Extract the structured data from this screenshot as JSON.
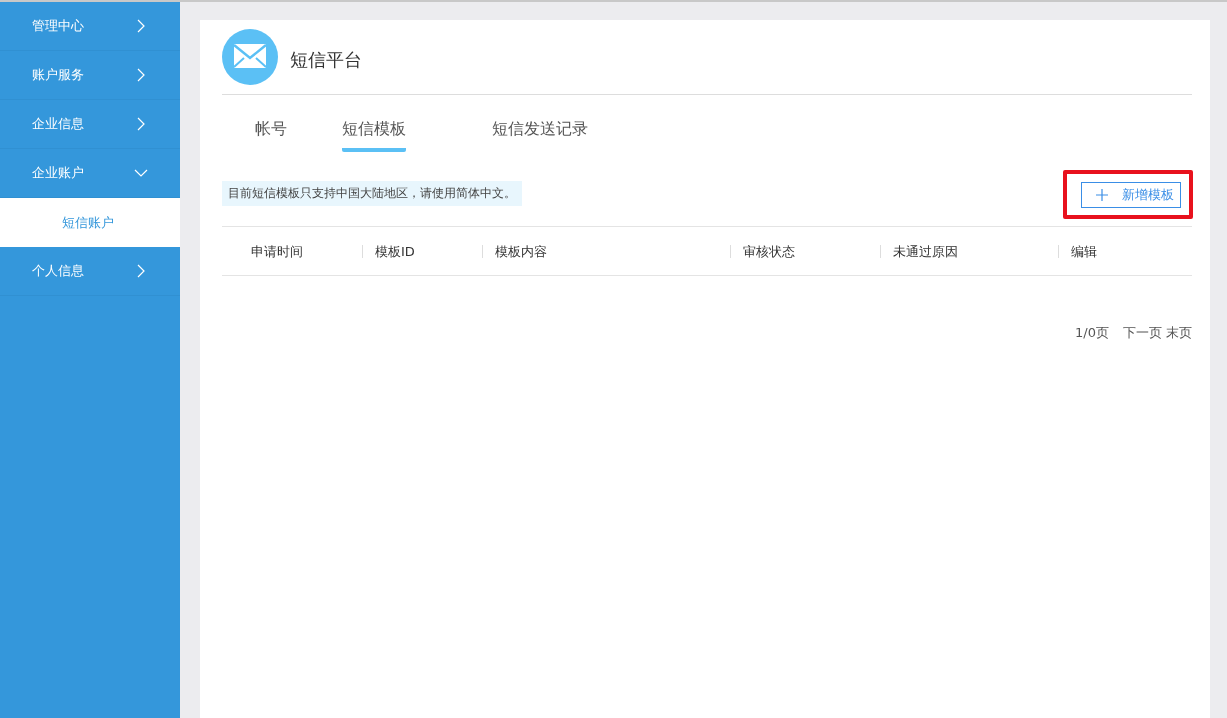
{
  "sidebar": {
    "items": [
      {
        "label": "管理中心",
        "expanded": false
      },
      {
        "label": "账户服务",
        "expanded": false
      },
      {
        "label": "企业信息",
        "expanded": false
      },
      {
        "label": "企业账户",
        "expanded": true,
        "children": [
          {
            "label": "短信账户",
            "selected": true
          }
        ]
      },
      {
        "label": "个人信息",
        "expanded": false
      }
    ]
  },
  "page": {
    "title": "短信平台"
  },
  "tabs": [
    {
      "label": "帐号",
      "selected": false
    },
    {
      "label": "短信模板",
      "selected": true
    },
    {
      "label": "短信发送记录",
      "selected": false
    }
  ],
  "notice": "目前短信模板只支持中国大陆地区，请使用简体中文。",
  "add_button": {
    "label": "新增模板",
    "highlighted": true
  },
  "table": {
    "columns": [
      "申请时间",
      "模板ID",
      "模板内容",
      "审核状态",
      "未通过原因",
      "编辑"
    ]
  },
  "pagination": {
    "pages": "1/0页",
    "next": "下一页",
    "last": "末页"
  }
}
